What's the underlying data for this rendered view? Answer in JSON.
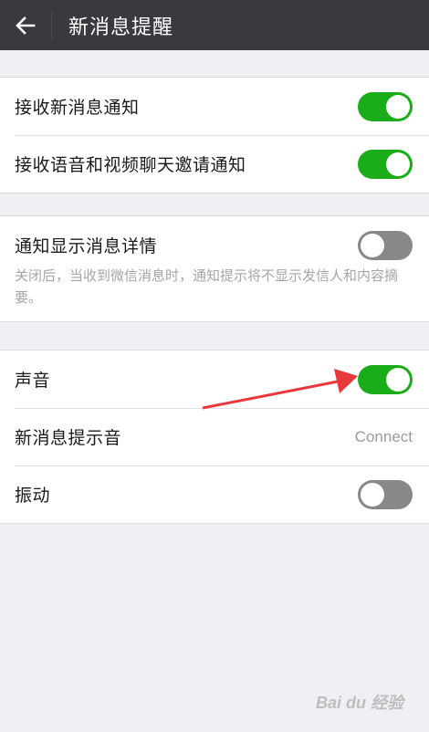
{
  "header": {
    "title": "新消息提醒",
    "back_icon": "arrow-left-icon"
  },
  "group1": {
    "rows": [
      {
        "label": "接收新消息通知",
        "toggle": true
      },
      {
        "label": "接收语音和视频聊天邀请通知",
        "toggle": true
      }
    ]
  },
  "group2": {
    "label": "通知显示消息详情",
    "toggle": false,
    "description": "关闭后，当收到微信消息时，通知提示将不显示发信人和内容摘要。"
  },
  "group3": {
    "sound_label": "声音",
    "sound_toggle": true,
    "ringtone_label": "新消息提示音",
    "ringtone_value": "Connect",
    "vibrate_label": "振动",
    "vibrate_toggle": false
  },
  "colors": {
    "toggle_on": "#1aad19",
    "toggle_off": "#888888",
    "header_bg": "#393a3f",
    "annotation_arrow": "#e8383d"
  },
  "watermark": {
    "text": "Bai du 经验"
  }
}
